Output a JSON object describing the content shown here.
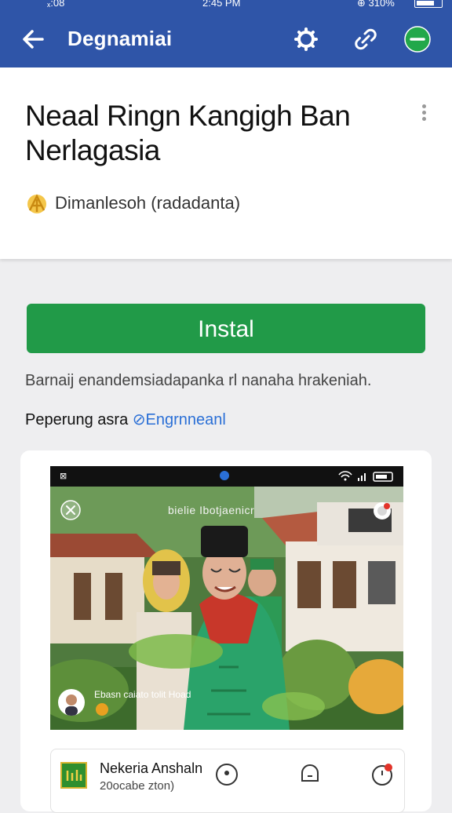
{
  "status_bar": {
    "left": "ₓ:08",
    "time": "2:45 PM",
    "right": "⊕ 310%"
  },
  "app_bar": {
    "title": "Degnamiai",
    "icons": [
      "back-arrow-icon",
      "search-icon",
      "link-icon",
      "minus-circle-icon"
    ],
    "accent": "#2f55a8"
  },
  "app": {
    "name": "Neaal Ringn Kangigh Ban Nerlagasia",
    "developer": "Dimanlesoh (radadanta)"
  },
  "install_label": "Instal",
  "install_color": "#219a48",
  "notice": "Barnaij enandemsiadapanka rl nanaha hrakeniah.",
  "contains": {
    "prefix": "Peperung asra",
    "link": "⊘Engrnneanl"
  },
  "screenshot": {
    "status_left": "⊠",
    "caption": "bielie Ibotjaenicr",
    "user": "Ebasn caiato tolit Hoad"
  },
  "mini_bar": {
    "title": "Nekeria Anshaln",
    "subtitle": "20ocabe zton)"
  }
}
